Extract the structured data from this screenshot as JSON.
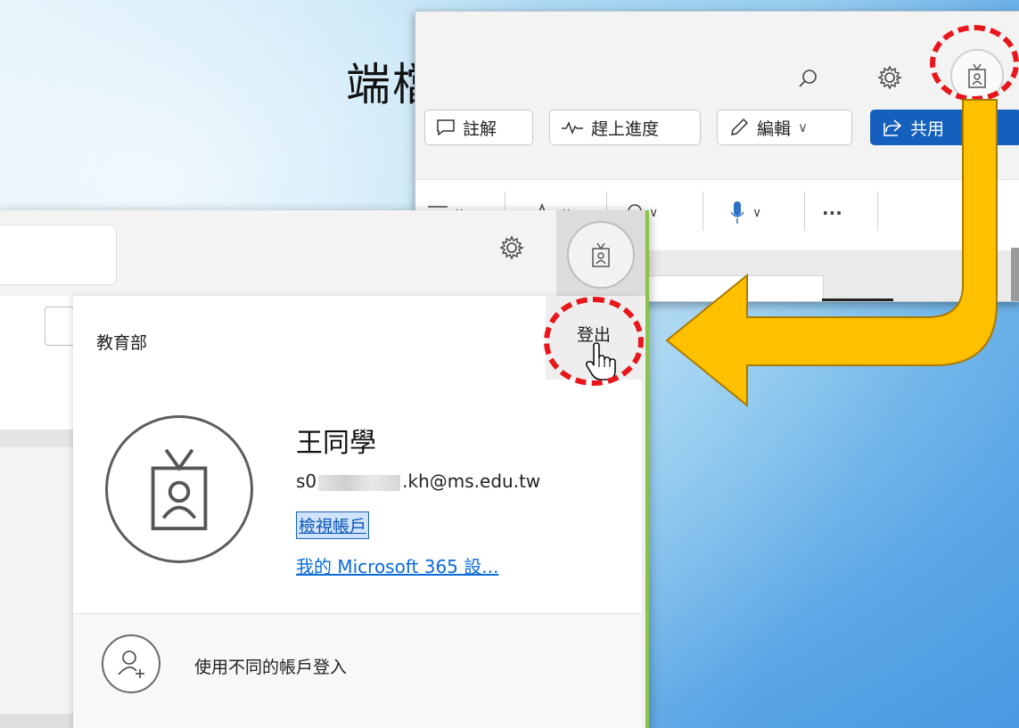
{
  "slide": {
    "heading": "端檔案就"
  },
  "top_panel": {
    "search_icon": "search-icon",
    "gear_icon": "gear-icon",
    "avatar_icon": "badge-avatar-icon",
    "commands": [
      {
        "label": "註解",
        "icon": "comment-icon"
      },
      {
        "label": "趕上進度",
        "icon": "pulse-icon"
      },
      {
        "label": "編輯",
        "icon": "pencil-icon",
        "chevron": "∨"
      },
      {
        "label": "共用",
        "icon": "share-icon"
      }
    ],
    "ribbon": {
      "align_chevron": "∨",
      "style_chevron": "∨",
      "find_chevron": "∨",
      "mic_chevron": "∨",
      "more": "···"
    },
    "share_color": "#1560bd"
  },
  "account_popup": {
    "org_name": "教育部",
    "sign_out": "登出",
    "user_name": "王同學",
    "email_prefix": "s0",
    "email_suffix": ".kh@ms.edu.tw",
    "view_account": "檢視帳戶",
    "m365_settings": "我的 Microsoft 365 設...",
    "other_account": "使用不同的帳戶登入"
  },
  "annotations": {
    "circle_color": "#e8161b",
    "arrow_color": "#ffc000"
  }
}
